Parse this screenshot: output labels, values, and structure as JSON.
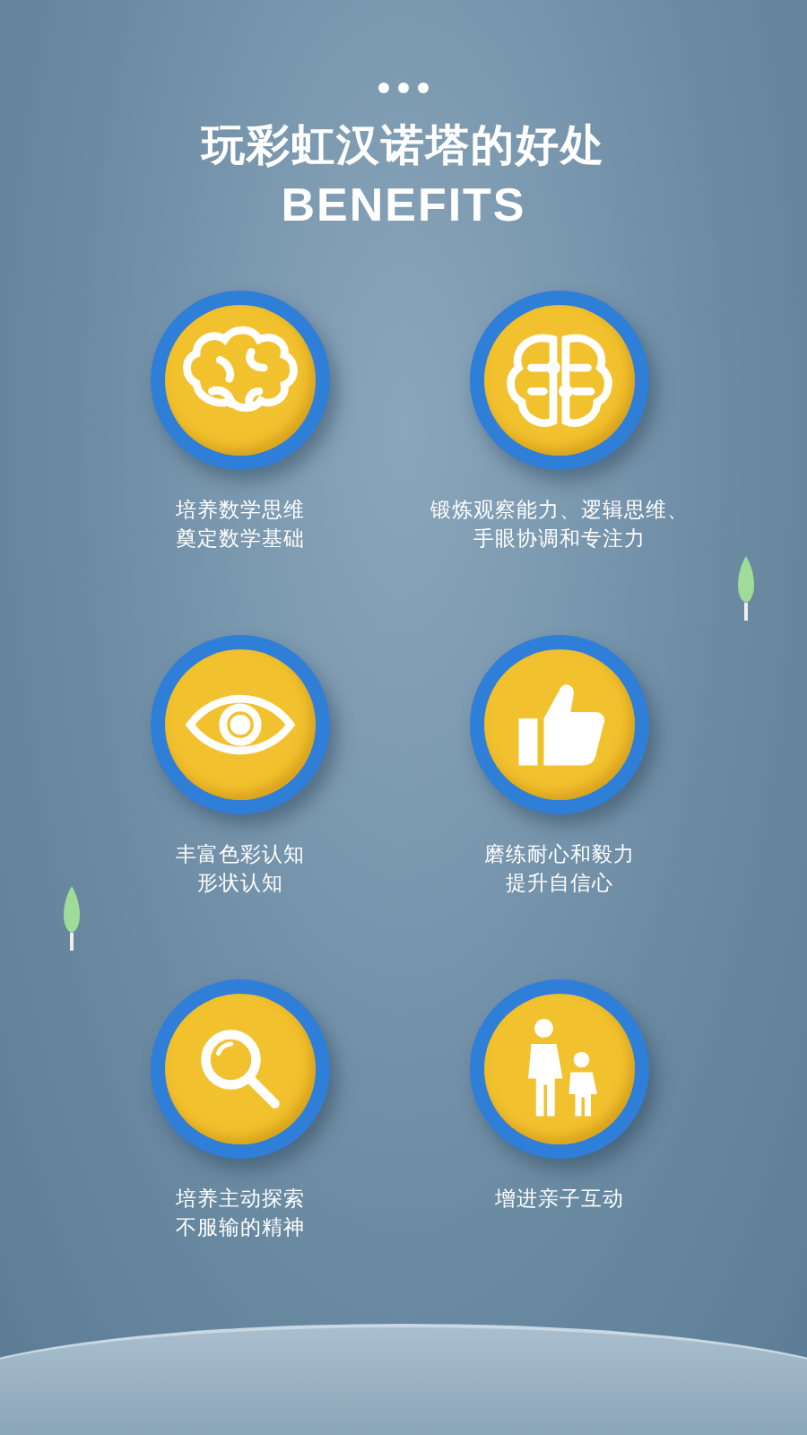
{
  "header": {
    "title": "玩彩虹汉诺塔的好处",
    "subtitle": "BENEFITS"
  },
  "benefits": [
    {
      "lines": [
        "培养数学思维",
        "奠定数学基础"
      ]
    },
    {
      "lines": [
        "锻炼观察能力、逻辑思维、",
        "手眼协调和专注力"
      ]
    },
    {
      "lines": [
        "丰富色彩认知",
        "形状认知"
      ]
    },
    {
      "lines": [
        "磨练耐心和毅力",
        "提升自信心"
      ]
    },
    {
      "lines": [
        "培养主动探索",
        "不服输的精神"
      ]
    },
    {
      "lines": [
        "增进亲子互动"
      ]
    }
  ]
}
